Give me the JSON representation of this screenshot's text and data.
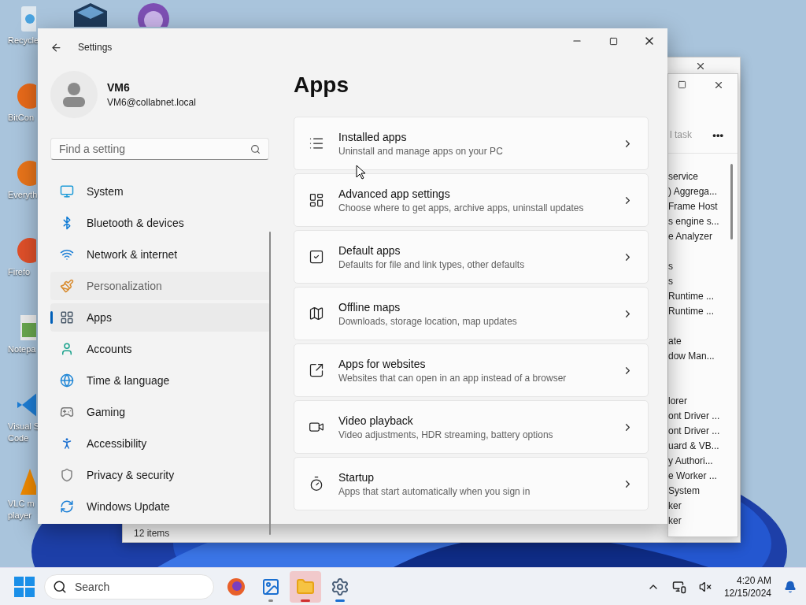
{
  "desktop_icons": [
    {
      "lines": [
        "Recycle"
      ]
    },
    {
      "lines": [
        "BitCon"
      ]
    },
    {
      "lines": [
        "Everyth"
      ]
    },
    {
      "lines": [
        "Firefo"
      ]
    },
    {
      "lines": [
        "Notepa"
      ]
    },
    {
      "lines": [
        "Visual S",
        "Code"
      ]
    },
    {
      "lines": [
        "VLC m",
        "player"
      ]
    }
  ],
  "explorer_window": {
    "status": "12 items"
  },
  "task_manager": {
    "toolbar_text": "l task",
    "more": "•••",
    "rows": [
      {
        "kind": "item",
        "text": "service"
      },
      {
        "kind": "item",
        "text": ") Aggrega..."
      },
      {
        "kind": "item",
        "text": "Frame Host"
      },
      {
        "kind": "item",
        "text": "s engine s..."
      },
      {
        "kind": "item",
        "text": "e Analyzer"
      },
      {
        "kind": "blank"
      },
      {
        "kind": "item",
        "text": "s"
      },
      {
        "kind": "item",
        "text": "s"
      },
      {
        "kind": "item",
        "text": "Runtime ..."
      },
      {
        "kind": "item",
        "text": "Runtime ..."
      },
      {
        "kind": "blank"
      },
      {
        "kind": "item",
        "text": "ate"
      },
      {
        "kind": "item",
        "text": "dow Man..."
      },
      {
        "kind": "blank"
      },
      {
        "kind": "blank"
      },
      {
        "kind": "item",
        "text": "lorer"
      },
      {
        "kind": "item",
        "text": "ont Driver ..."
      },
      {
        "kind": "item",
        "text": "ont Driver ..."
      },
      {
        "kind": "item",
        "text": "uard & VB..."
      },
      {
        "kind": "item",
        "text": "y Authori..."
      },
      {
        "kind": "item",
        "text": "e Worker ..."
      },
      {
        "kind": "item",
        "text": "System"
      },
      {
        "kind": "item",
        "text": "ker"
      },
      {
        "kind": "item",
        "text": "ker"
      }
    ]
  },
  "window": {
    "title": "Settings"
  },
  "profile": {
    "name": "VM6",
    "email": "VM6@collabnet.local"
  },
  "search": {
    "placeholder": "Find a setting"
  },
  "sidebar": {
    "items": [
      {
        "label": "System",
        "selected": false,
        "hovered": false
      },
      {
        "label": "Bluetooth & devices",
        "selected": false,
        "hovered": false
      },
      {
        "label": "Network & internet",
        "selected": false,
        "hovered": false
      },
      {
        "label": "Personalization",
        "selected": false,
        "hovered": true
      },
      {
        "label": "Apps",
        "selected": true,
        "hovered": false
      },
      {
        "label": "Accounts",
        "selected": false,
        "hovered": false
      },
      {
        "label": "Time & language",
        "selected": false,
        "hovered": false
      },
      {
        "label": "Gaming",
        "selected": false,
        "hovered": false
      },
      {
        "label": "Accessibility",
        "selected": false,
        "hovered": false
      },
      {
        "label": "Privacy & security",
        "selected": false,
        "hovered": false
      },
      {
        "label": "Windows Update",
        "selected": false,
        "hovered": false
      }
    ]
  },
  "page": {
    "title": "Apps",
    "cards": [
      {
        "title": "Installed apps",
        "description": "Uninstall and manage apps on your PC"
      },
      {
        "title": "Advanced app settings",
        "description": "Choose where to get apps, archive apps, uninstall updates"
      },
      {
        "title": "Default apps",
        "description": "Defaults for file and link types, other defaults"
      },
      {
        "title": "Offline maps",
        "description": "Downloads, storage location, map updates"
      },
      {
        "title": "Apps for websites",
        "description": "Websites that can open in an app instead of a browser"
      },
      {
        "title": "Video playback",
        "description": "Video adjustments, HDR streaming, battery options"
      },
      {
        "title": "Startup",
        "description": "Apps that start automatically when you sign in"
      }
    ]
  },
  "taskbar": {
    "search_placeholder": "Search",
    "apps": [
      {
        "selected": false,
        "running": false
      },
      {
        "selected": false,
        "running": true
      },
      {
        "selected": true,
        "running": true
      },
      {
        "selected": false,
        "running": true
      }
    ],
    "time": "4:20 AM",
    "date": "12/15/2024"
  }
}
